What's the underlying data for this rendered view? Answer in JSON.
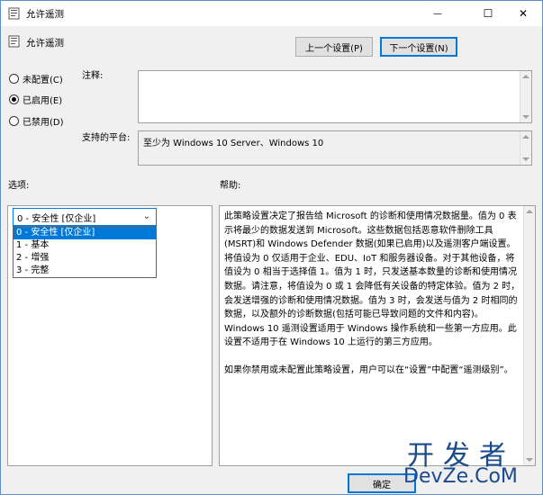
{
  "window": {
    "title": "允许遥测",
    "minimize_glyph": "—",
    "maximize_glyph": "☐",
    "close_glyph": "✕"
  },
  "header": {
    "policy_name": "允许遥测",
    "prev_button": "上一个设置(P)",
    "next_button": "下一个设置(N)"
  },
  "state": {
    "options": [
      {
        "label": "未配置(C)",
        "selected": false
      },
      {
        "label": "已启用(E)",
        "selected": true
      },
      {
        "label": "已禁用(D)",
        "selected": false
      }
    ]
  },
  "comment": {
    "label": "注释:",
    "value": ""
  },
  "platform": {
    "label": "支持的平台:",
    "value": "至少为 Windows 10 Server、Windows 10"
  },
  "options_section": {
    "label": "选项:",
    "select_value": "0 - 安全性 [仅企业]",
    "dropdown_items": [
      "0 - 安全性 [仅企业]",
      "1 - 基本",
      "2 - 增强",
      "3 - 完整"
    ]
  },
  "help_section": {
    "label": "帮助:",
    "paragraphs": [
      "此策略设置决定了报告给 Microsoft 的诊断和使用情况数据量。值为 0 表示将最少的数据发送到 Microsoft。这些数据包括恶意软件删除工具(MSRT)和 Windows Defender 数据(如果已启用)以及遥测客户端设置。将值设为 0 仅适用于企业、EDU、IoT 和服务器设备。对于其他设备，将值设为 0 相当于选择值 1。值为 1 时，只发送基本数量的诊断和使用情况数据。请注意，将值设为 0 或 1 会降低有关设备的特定体验。值为 2 时，会发送增强的诊断和使用情况数据。值为 3 时，会发送与值为 2 时相同的数据，以及额外的诊断数据(包括可能已导致问题的文件和内容)。Windows 10 遥测设置适用于 Windows 操作系统和一些第一方应用。此设置不适用于在 Windows 10 上运行的第三方应用。",
      "如果你禁用或未配置此策略设置，用户可以在“设置”中配置“遥测级别”。"
    ]
  },
  "footer": {
    "ok_button": "确定"
  },
  "watermark": {
    "top": "开发者",
    "bottom": "DevZe.CoM"
  },
  "colors": {
    "accent": "#0078d7",
    "window_bg": "#f0f0f0",
    "watermark": "#1a4a8a"
  }
}
